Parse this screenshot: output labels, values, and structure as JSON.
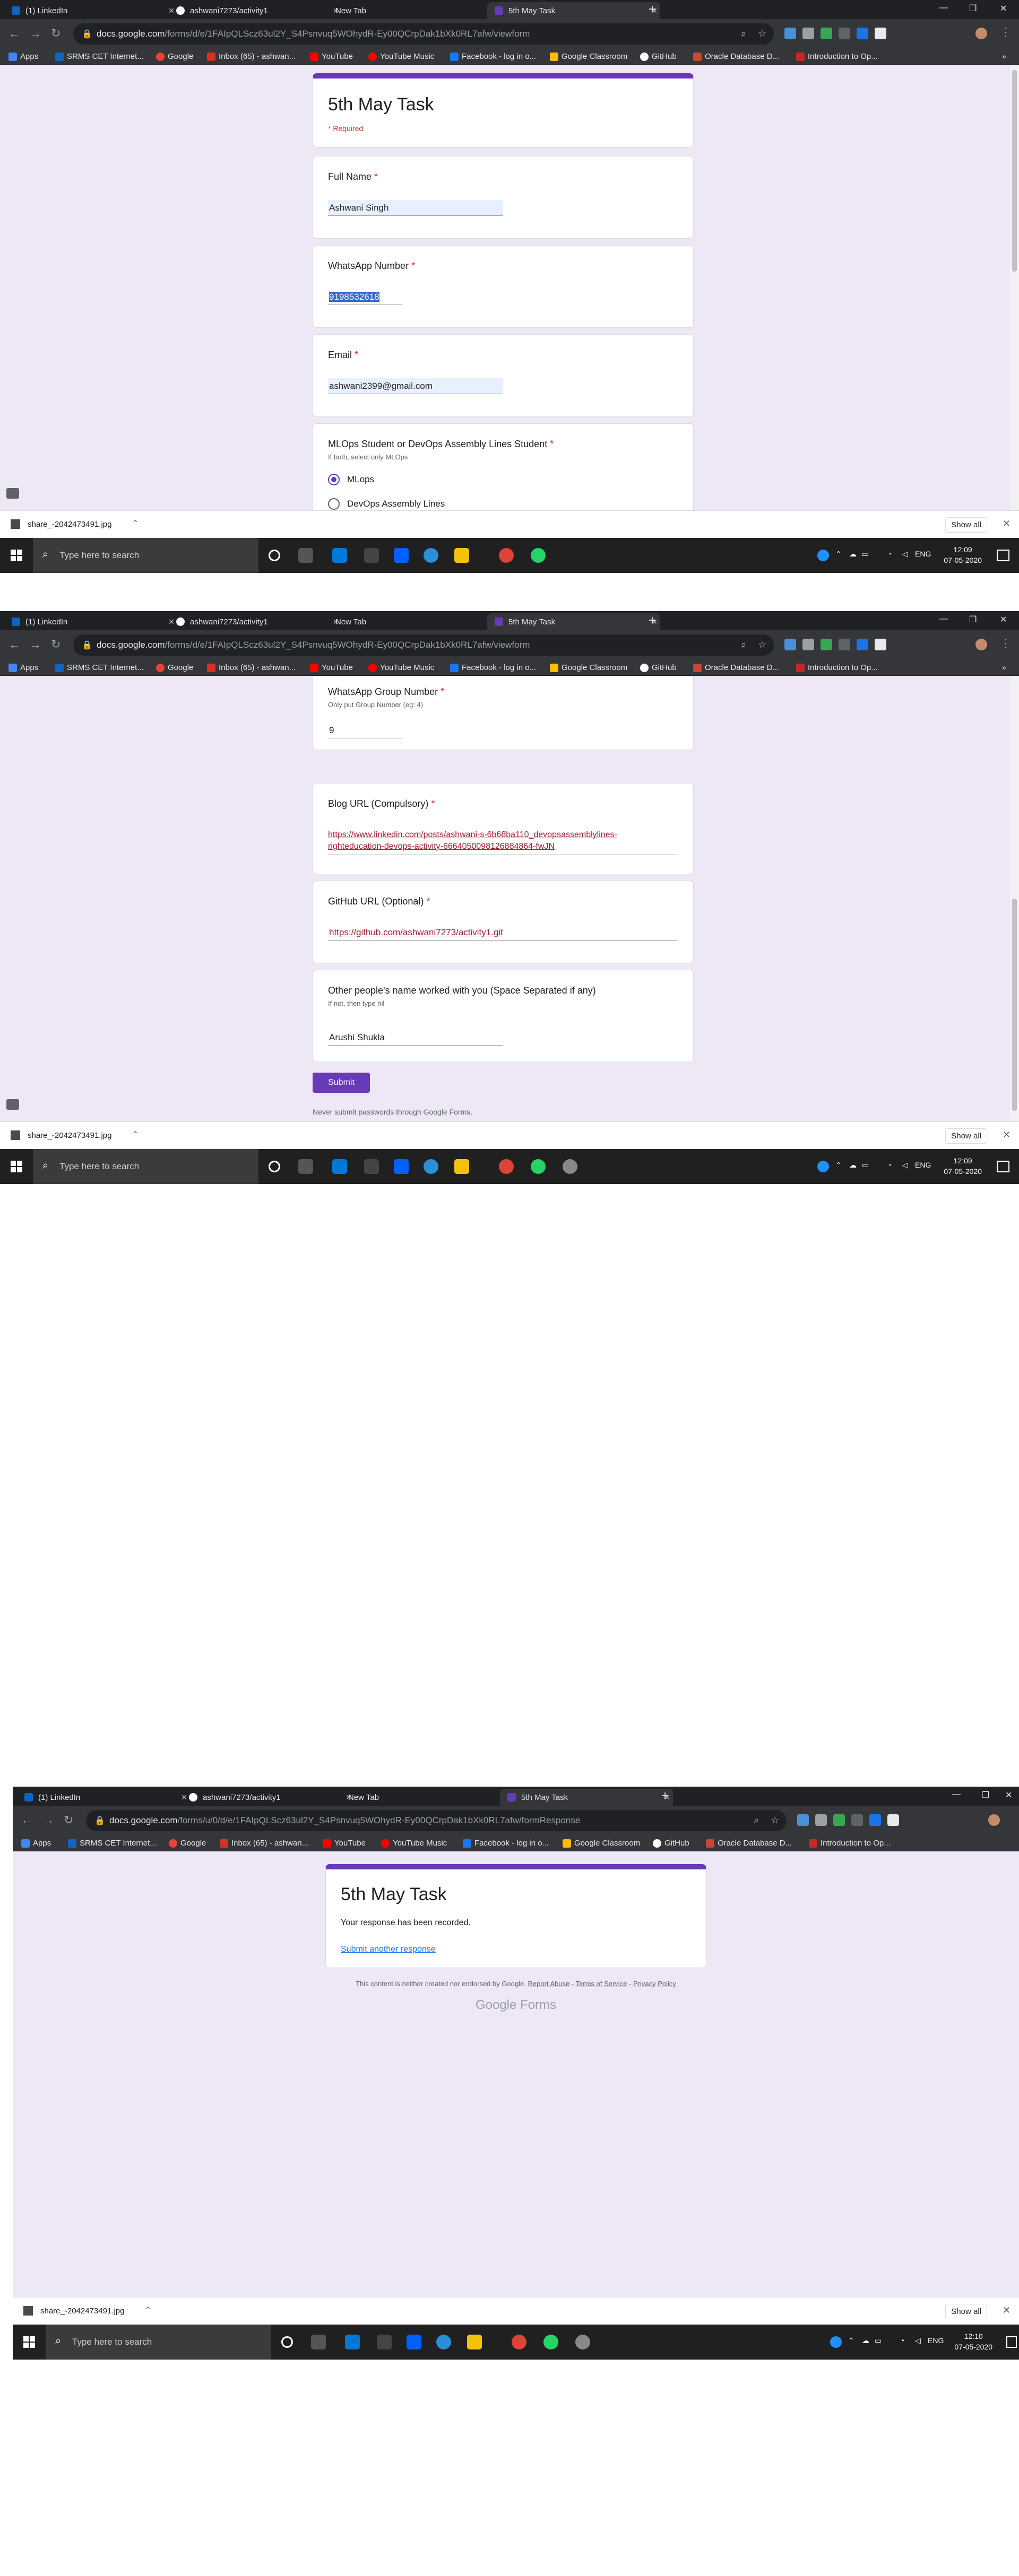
{
  "tabs": [
    {
      "label": "(1) LinkedIn"
    },
    {
      "label": "ashwani7273/activity1"
    },
    {
      "label": "New Tab"
    },
    {
      "label": "5th May Task"
    }
  ],
  "address": {
    "host": "docs.google.com",
    "path": "/forms/d/e/1FAIpQLScz63ul2Y_S4Psnvuq5WOhydR-Ey00QCrpDak1bXk0RL7afw/viewform",
    "path_response": "/forms/u/0/d/e/1FAIpQLScz63ul2Y_S4Psnvuq5WOhydR-Ey00QCrpDak1bXk0RL7afw/formResponse"
  },
  "bookmarks": [
    {
      "label": "Apps",
      "color": "#4285f4"
    },
    {
      "label": "SRMS CET Internet...",
      "color": "#1565c0"
    },
    {
      "label": "Google",
      "color": "#ea4335"
    },
    {
      "label": "Inbox (65) - ashwan...",
      "color": "#d93025"
    },
    {
      "label": "YouTube",
      "color": "#ff0000"
    },
    {
      "label": "YouTube Music",
      "color": "#ff0000"
    },
    {
      "label": "Facebook - log in o...",
      "color": "#1877f2"
    },
    {
      "label": "Google Classroom",
      "color": "#fbbc04"
    },
    {
      "label": "GitHub",
      "color": "#ffffff"
    },
    {
      "label": "Oracle Database D...",
      "color": "#c74634"
    },
    {
      "label": "Introduction to Op...",
      "color": "#c62828"
    }
  ],
  "form": {
    "title": "5th May Task",
    "required_note": "* Required",
    "full_name": {
      "label": "Full Name",
      "value": "Ashwani Singh"
    },
    "whatsapp": {
      "label": "WhatsApp Number",
      "value": "9198532618"
    },
    "email": {
      "label": "Email",
      "value": "ashwani2399@gmail.com"
    },
    "track": {
      "label": "MLOps Student or DevOps Assembly Lines Student",
      "help": "If both, select only MLOps",
      "options": [
        "MLops",
        "DevOps Assembly Lines"
      ]
    },
    "group": {
      "label": "WhatsApp Group Number",
      "help": "Only put Group Number (eg: 4)",
      "value": "9"
    },
    "blog": {
      "label": "Blog URL (Compulsory)",
      "value_line1": "https://www.linkedin.com/posts/ashwani-s-6b68ba110_devopsassemblylines-",
      "value_line2": "righteducation-devops-activity-6664050098126884864-fwJN"
    },
    "github": {
      "label": "GitHub URL (Optional)",
      "value": "https://github.com/ashwani7273/activity1.git"
    },
    "others": {
      "label": "Other people's name worked with you (Space Separated if any)",
      "help": "If not, then type nil",
      "value": "Arushi Shukla"
    },
    "required_mark": "*",
    "submit": "Submit",
    "password_note": "Never submit passwords through Google Forms."
  },
  "response": {
    "title": "5th May Task",
    "recorded": "Your response has been recorded.",
    "another": "Submit another response",
    "disclaimer": "This content is neither created nor endorsed by Google.",
    "report": "Report Abuse",
    "terms": "Terms of Service",
    "privacy": "Privacy Policy",
    "brand": "Google Forms"
  },
  "download": {
    "file": "share_-2042473491.jpg",
    "show_all": "Show all"
  },
  "taskbar": {
    "search": "Type here to search",
    "lang": "ENG",
    "date": "07-05-2020",
    "time1": "12:09",
    "time2": "12:09",
    "time3": "12:10"
  },
  "colors": {
    "accent": "#673ab7",
    "background": "#ede7f6",
    "required": "#d93025"
  }
}
